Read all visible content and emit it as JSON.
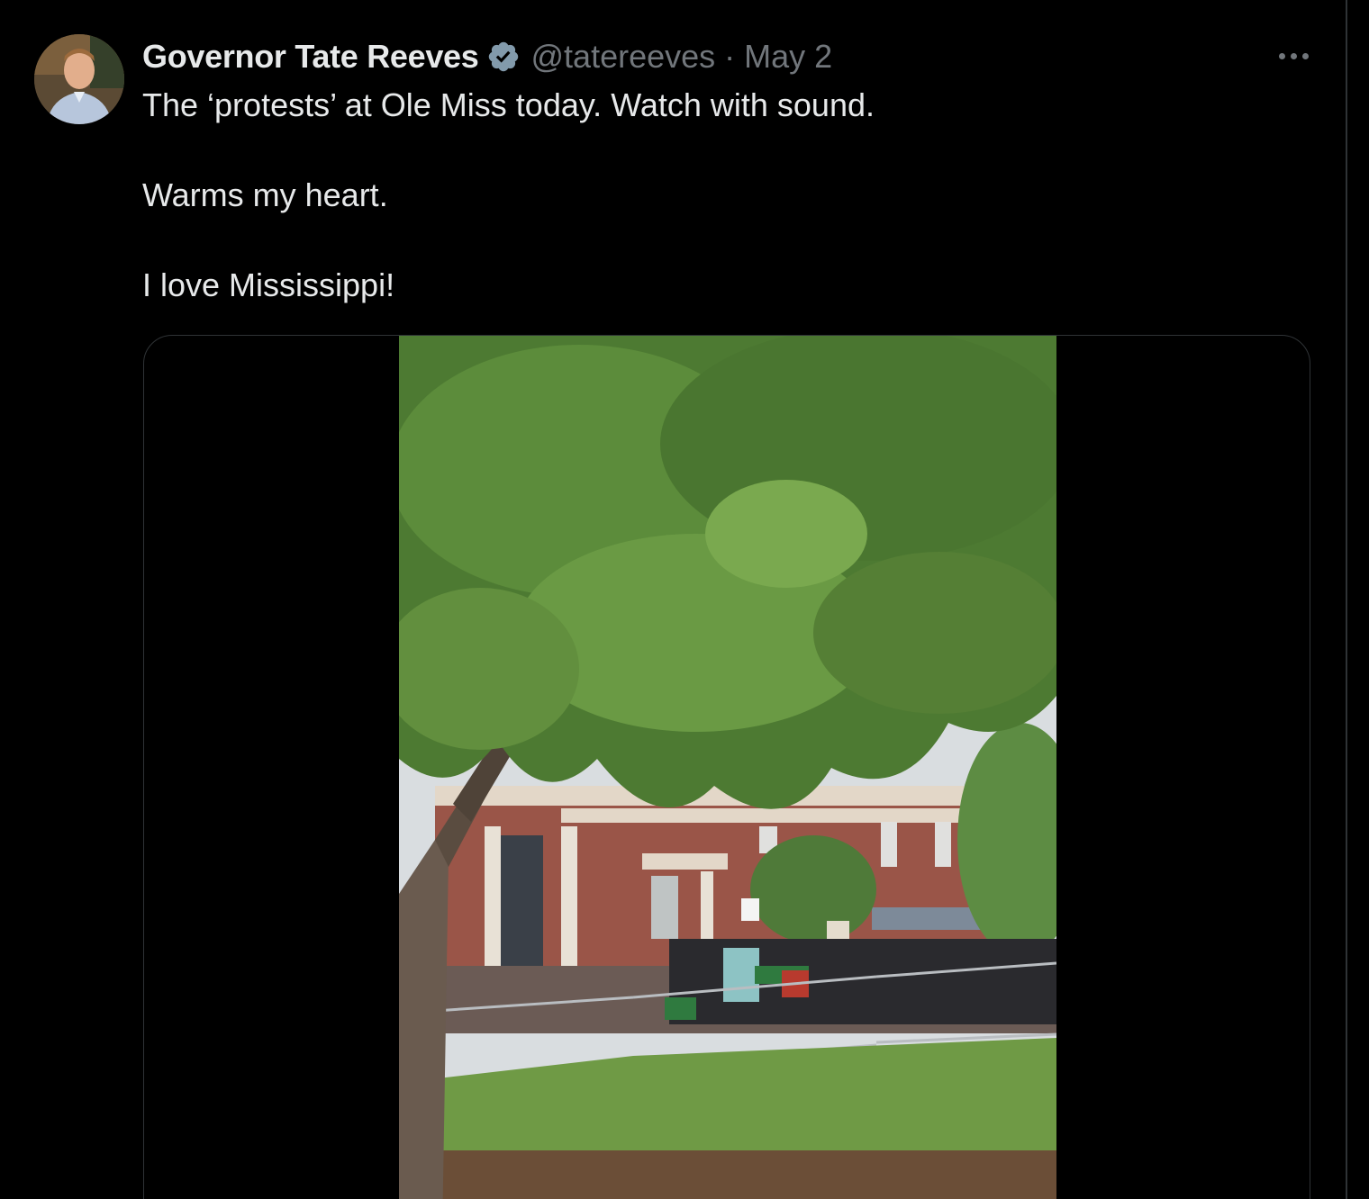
{
  "tweet": {
    "display_name": "Governor Tate Reeves",
    "handle": "@tatereeves",
    "separator": "·",
    "timestamp": "May 2",
    "text_lines": [
      "The ‘protests’ at Ole Miss today. Watch with sound.",
      "Warms my heart.",
      "I love Mississippi!"
    ],
    "icons": {
      "verified": "verified-badge-icon",
      "more": "more-options-icon"
    },
    "media": {
      "type": "video"
    }
  },
  "colors": {
    "background": "#000000",
    "text_primary": "#e7e9ea",
    "text_secondary": "#71767b",
    "border": "#2f3336",
    "verified_badge": "#829aab"
  }
}
